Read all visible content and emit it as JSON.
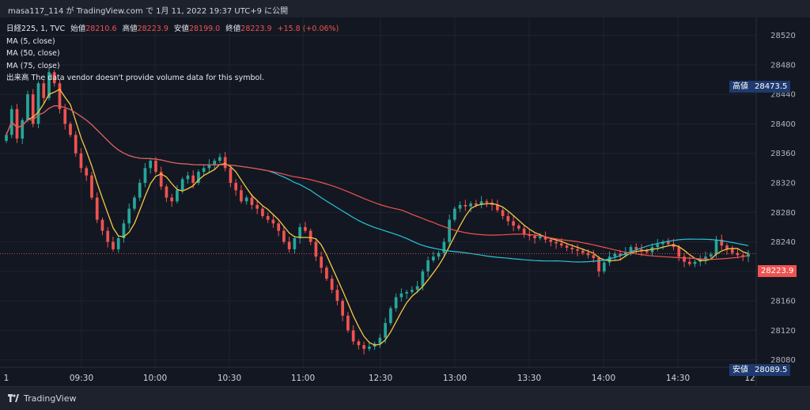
{
  "header": {
    "title": "masa117_114 が TradingView.com で 1月 11, 2022 19:37 UTC+9 に公開"
  },
  "legend": {
    "symbol": "日経225, 1, TVC",
    "open_label": "始値",
    "open": "28210.6",
    "high_label": "高値",
    "high": "28223.9",
    "low_label": "安値",
    "low": "28199.0",
    "close_label": "終値",
    "close": "28223.9",
    "change": "+15.8 (+0.06%)",
    "ma5": "MA (5, close)",
    "ma50": "MA (50, close)",
    "ma75": "MA (75, close)",
    "volume_note": "出来高  The data vendor doesn't provide volume data for this symbol."
  },
  "price_labels": {
    "high_label": "高値",
    "high_value": "28473.5",
    "current_value": "28223.9",
    "low_label": "安値",
    "low_value": "28089.5"
  },
  "footer": {
    "brand": "TradingView"
  },
  "colors": {
    "background": "#131722",
    "up": "#26a69a",
    "down": "#ef5350",
    "ma5": "#f5c842",
    "ma50": "#26c6da",
    "ma75": "#ef5350",
    "label_bg": "#1e3a6e"
  },
  "chart_data": {
    "type": "candlestick",
    "title": "日経225, 1, TVC",
    "interval": "1 minute",
    "ylim": [
      28070,
      28540
    ],
    "y_ticks": [
      28080,
      28120,
      28160,
      28200,
      28240,
      28280,
      28320,
      28360,
      28400,
      28440,
      28480,
      28520
    ],
    "x_tick_labels": [
      "1",
      "09:30",
      "10:00",
      "10:30",
      "11:00",
      "12:30",
      "13:00",
      "13:30",
      "14:00",
      "14:30",
      "12"
    ],
    "grid": true,
    "series": [
      {
        "name": "MA (5, close)",
        "color": "#f5c842"
      },
      {
        "name": "MA (50, close)",
        "color": "#26c6da"
      },
      {
        "name": "MA (75, close)",
        "color": "#ef5350"
      }
    ],
    "closes": [
      28385,
      28420,
      28380,
      28405,
      28440,
      28400,
      28455,
      28435,
      28470,
      28455,
      28420,
      28400,
      28385,
      28360,
      28340,
      28330,
      28300,
      28270,
      28255,
      28240,
      28230,
      28245,
      28265,
      28285,
      28300,
      28320,
      28340,
      28350,
      28335,
      28315,
      28300,
      28295,
      28310,
      28325,
      28330,
      28320,
      28335,
      28340,
      28345,
      28350,
      28355,
      28340,
      28320,
      28310,
      28295,
      28300,
      28290,
      28285,
      28275,
      28270,
      28265,
      28255,
      28240,
      28230,
      28245,
      28260,
      28255,
      28240,
      28220,
      28205,
      28190,
      28175,
      28160,
      28140,
      28120,
      28105,
      28100,
      28095,
      28098,
      28102,
      28110,
      28130,
      28150,
      28165,
      28170,
      28172,
      28175,
      28180,
      28200,
      28215,
      28220,
      28225,
      28240,
      28270,
      28285,
      28290,
      28288,
      28292,
      28290,
      28295,
      28293,
      28290,
      28283,
      28275,
      28268,
      28262,
      28258,
      28250,
      28248,
      28245,
      28247,
      28243,
      28240,
      28238,
      28235,
      28232,
      28230,
      28228,
      28225,
      28222,
      28218,
      28200,
      28212,
      28220,
      28224,
      28222,
      28226,
      28233,
      28230,
      28228,
      28226,
      28233,
      28237,
      28240,
      28237,
      28233,
      28220,
      28213,
      28210,
      28213,
      28217,
      28220,
      28223,
      28243,
      28235,
      28230,
      28225,
      28222,
      28220,
      28224
    ]
  }
}
